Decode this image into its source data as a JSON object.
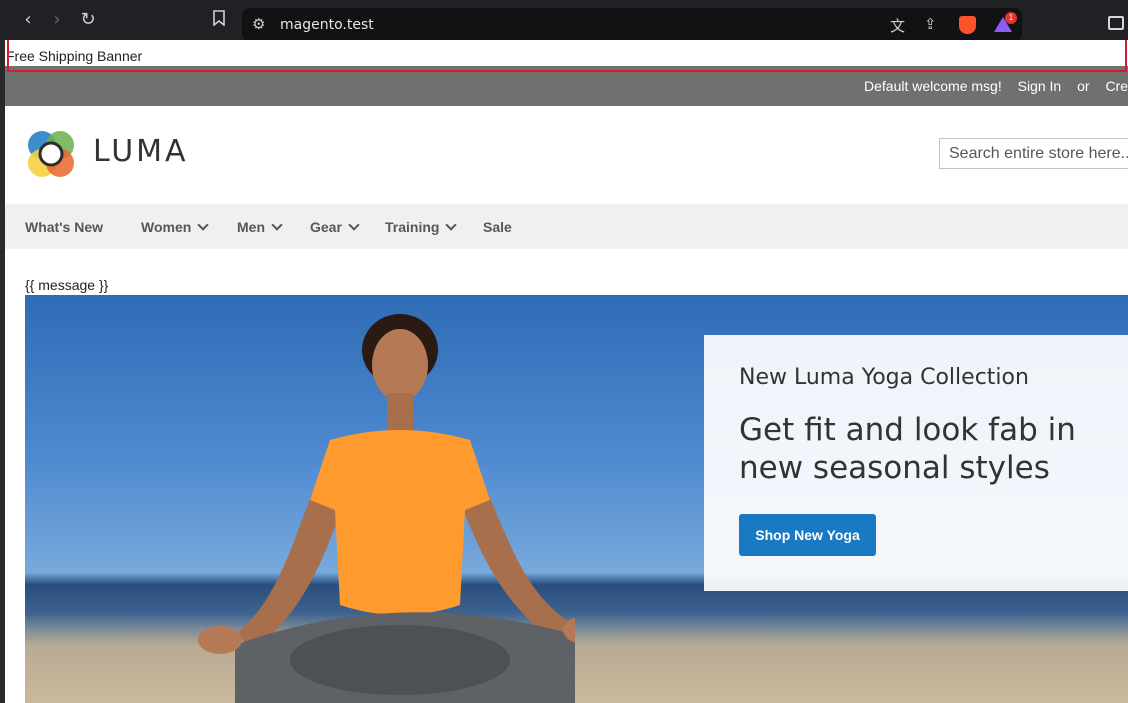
{
  "browser": {
    "url": "magento.test",
    "rewards_badge": "1"
  },
  "banner": {
    "text": "Free Shipping Banner"
  },
  "panel": {
    "welcome": "Default welcome msg!",
    "sign_in": "Sign In",
    "or": "or",
    "create": "Cre"
  },
  "header": {
    "logo_text": "LUMA",
    "search_placeholder": "Search entire store here..."
  },
  "nav": {
    "items": [
      {
        "label": "What's New",
        "has_submenu": false
      },
      {
        "label": "Women",
        "has_submenu": true
      },
      {
        "label": "Men",
        "has_submenu": true
      },
      {
        "label": "Gear",
        "has_submenu": true
      },
      {
        "label": "Training",
        "has_submenu": true
      },
      {
        "label": "Sale",
        "has_submenu": false
      }
    ]
  },
  "message": "{{ message }}",
  "promo": {
    "subtitle": "New Luma Yoga Collection",
    "title": "Get fit and look fab in new seasonal styles",
    "button": "Shop New Yoga"
  },
  "colors": {
    "highlight": "#d81b28",
    "panel_header": "#6e716e",
    "nav_bg": "#f0f0f0",
    "button": "#1979c3",
    "shirt": "#ff9a2e"
  },
  "icons": [
    "back-icon",
    "forward-icon",
    "reload-icon",
    "bookmark-icon",
    "site-settings-icon",
    "translate-icon",
    "share-icon",
    "brave-shield-icon",
    "brave-rewards-icon",
    "sidebar-icon",
    "luma-logo-icon",
    "chevron-down-icon"
  ]
}
